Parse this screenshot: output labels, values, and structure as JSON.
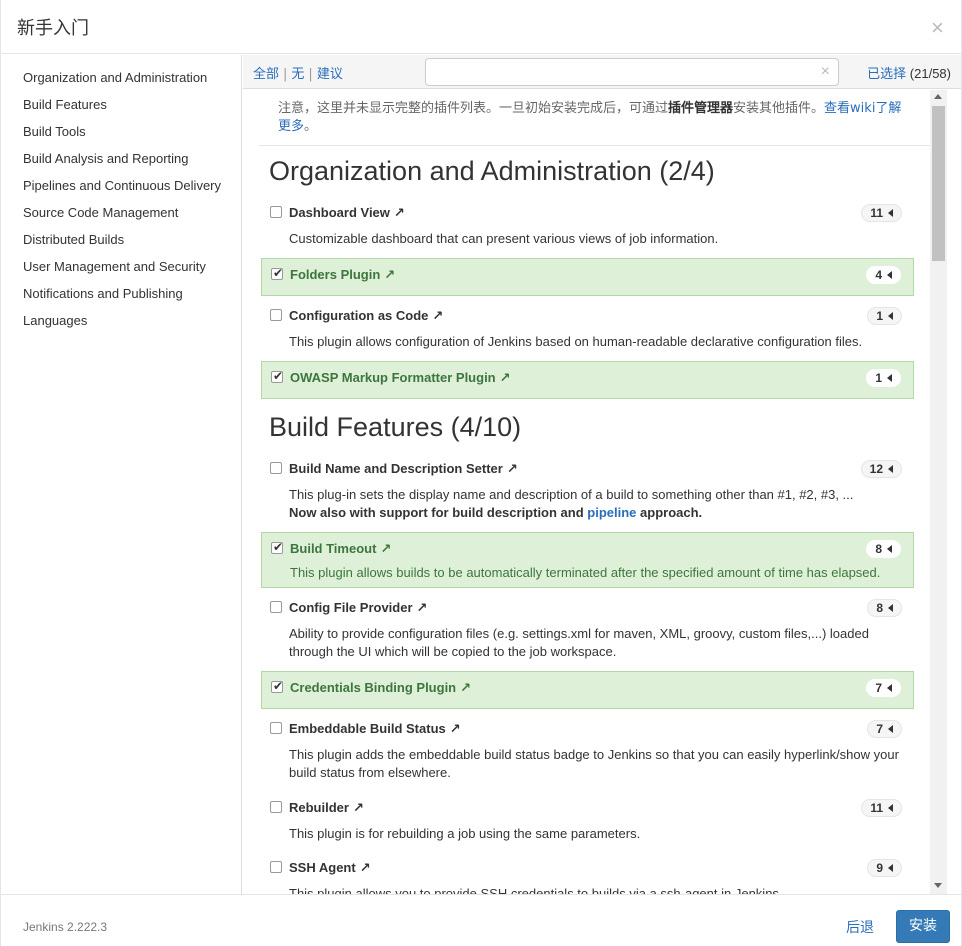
{
  "dialog": {
    "title": "新手入门",
    "close_glyph": "×"
  },
  "sidebar": {
    "items": [
      {
        "label": "Organization and Administration"
      },
      {
        "label": "Build Features"
      },
      {
        "label": "Build Tools"
      },
      {
        "label": "Build Analysis and Reporting"
      },
      {
        "label": "Pipelines and Continuous Delivery"
      },
      {
        "label": "Source Code Management"
      },
      {
        "label": "Distributed Builds"
      },
      {
        "label": "User Management and Security"
      },
      {
        "label": "Notifications and Publishing"
      },
      {
        "label": "Languages"
      }
    ]
  },
  "toolbar": {
    "filter_all": "全部",
    "filter_none": "无",
    "filter_suggested": "建议",
    "separator": "|",
    "search_value": "",
    "clear_glyph": "×",
    "selected_label": "已选择",
    "selected_count": "(21/58)"
  },
  "notice": {
    "text_before": "注意，这里并未显示完整的插件列表。一旦初始安装完成后，可通过",
    "bold": "插件管理器",
    "text_after": "安装其他插件。",
    "link": "查看wiki了解更多",
    "end": "。"
  },
  "sections": [
    {
      "title": "Organization and Administration (2/4)",
      "plugins": [
        {
          "name": "Dashboard View",
          "count": "11",
          "checked": false,
          "desc": "Customizable dashboard that can present various views of job information."
        },
        {
          "name": "Folders Plugin",
          "count": "4",
          "checked": true,
          "desc": ""
        },
        {
          "name": "Configuration as Code",
          "count": "1",
          "checked": false,
          "desc": "This plugin allows configuration of Jenkins based on human-readable declarative configuration files."
        },
        {
          "name": "OWASP Markup Formatter Plugin",
          "count": "1",
          "checked": true,
          "desc": ""
        }
      ]
    },
    {
      "title": "Build Features (4/10)",
      "plugins": [
        {
          "name": "Build Name and Description Setter",
          "count": "12",
          "checked": false,
          "desc": "This plug-in sets the display name and description of a build to something other than #1, #2, #3, ...",
          "desc2_bold": "Now also with support for build description and",
          "desc2_link": "pipeline",
          "desc2_end": "approach."
        },
        {
          "name": "Build Timeout",
          "count": "8",
          "checked": true,
          "desc": "This plugin allows builds to be automatically terminated after the specified amount of time has elapsed."
        },
        {
          "name": "Config File Provider",
          "count": "8",
          "checked": false,
          "desc": "Ability to provide configuration files (e.g. settings.xml for maven, XML, groovy, custom files,...) loaded through the UI which will be copied to the job workspace."
        },
        {
          "name": "Credentials Binding Plugin",
          "count": "7",
          "checked": true,
          "desc": ""
        },
        {
          "name": "Embeddable Build Status",
          "count": "7",
          "checked": false,
          "desc": "This plugin adds the embeddable build status badge to Jenkins so that you can easily hyperlink/show your build status from elsewhere."
        },
        {
          "name": "Rebuilder",
          "count": "11",
          "checked": false,
          "desc": "This plugin is for rebuilding a job using the same parameters."
        },
        {
          "name": "SSH Agent",
          "count": "9",
          "checked": false,
          "desc": "This plugin allows you to provide SSH credentials to builds via a ssh-agent in Jenkins."
        }
      ]
    }
  ],
  "external_glyph": "↗",
  "check_glyph": "✔",
  "footer": {
    "version": "Jenkins 2.222.3",
    "back_label": "后退",
    "install_label": "安装"
  }
}
